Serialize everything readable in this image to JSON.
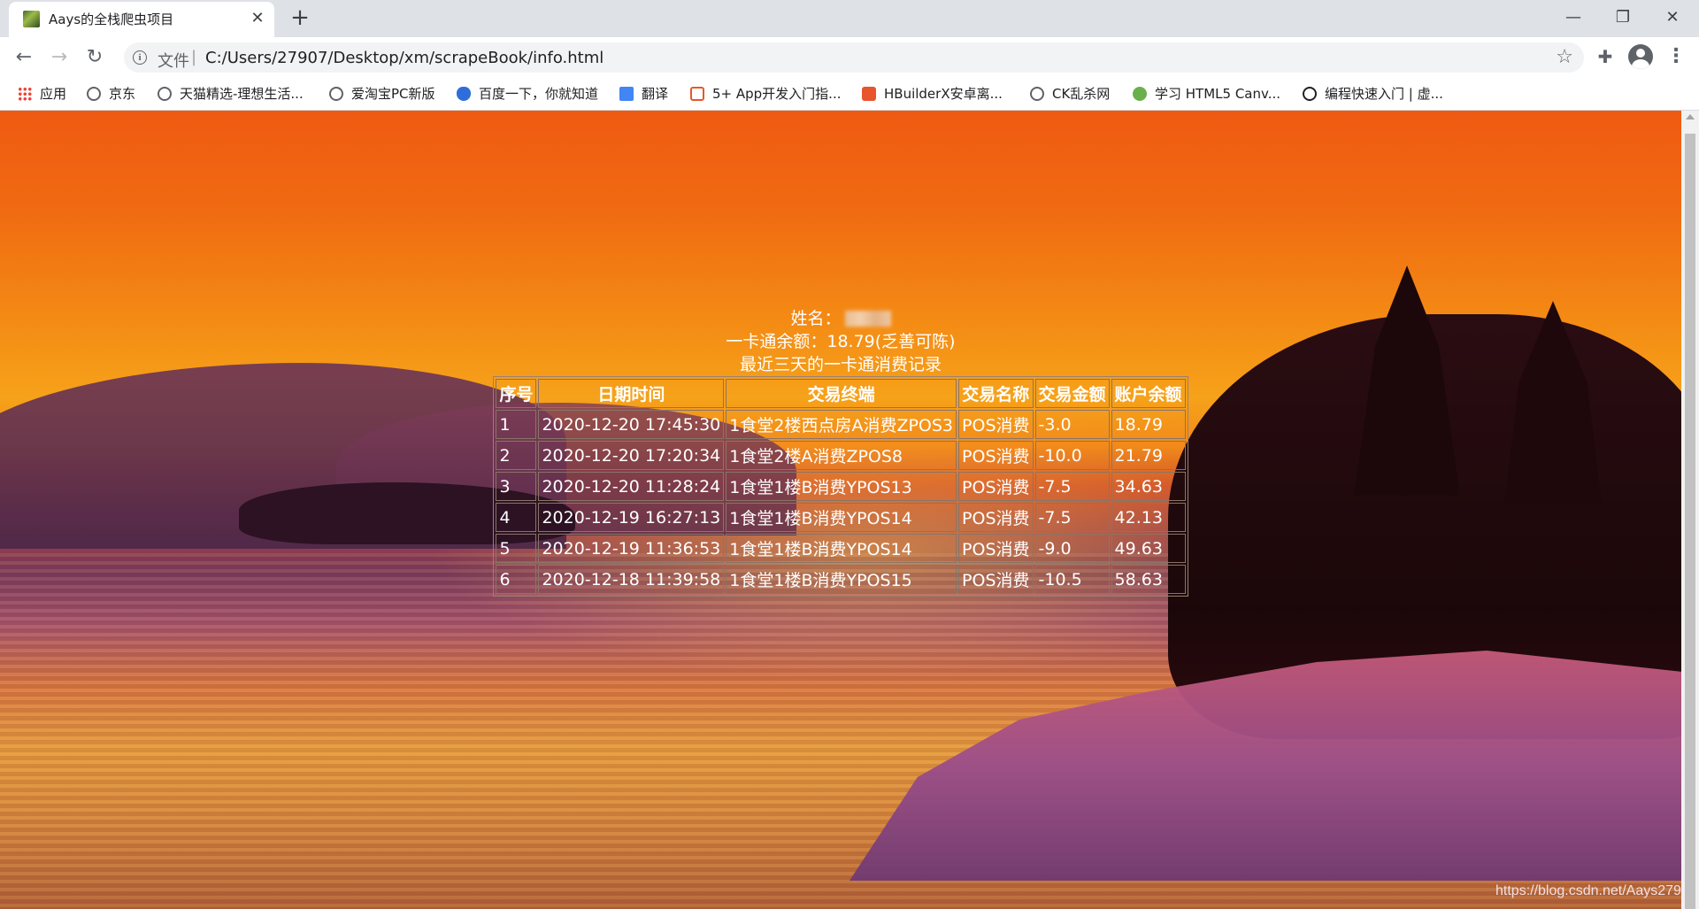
{
  "browser": {
    "tab_title": "Aays的全栈爬虫项目",
    "tab_close": "✕",
    "new_tab": "+",
    "window_minimize": "—",
    "window_restore": "❐",
    "window_close": "✕",
    "nav_back": "←",
    "nav_forward": "→",
    "nav_reload": "↻",
    "address_scheme": "文件",
    "address_separator": "|",
    "address_url": "C:/Users/27907/Desktop/xm/scrapeBook/info.html",
    "bookmark_star": "☆",
    "extensions_icon": "✚",
    "menu_icon": "⋮",
    "bookmarks": [
      {
        "label": "应用",
        "icon": "apps-grid-icon"
      },
      {
        "label": "京东",
        "icon": "globe-icon"
      },
      {
        "label": "天猫精选-理想生活...",
        "icon": "globe-icon"
      },
      {
        "label": "爱淘宝PC新版",
        "icon": "globe-icon"
      },
      {
        "label": "百度一下，你就知道",
        "icon": "baidu-paw-icon"
      },
      {
        "label": "翻译",
        "icon": "translate-icon"
      },
      {
        "label": "5+ App开发入门指...",
        "icon": "dcloud-icon"
      },
      {
        "label": "HBuilderX安卓离...",
        "icon": "hbuilder-icon"
      },
      {
        "label": "CK乱杀网",
        "icon": "globe-icon"
      },
      {
        "label": "学习 HTML5 Canv...",
        "icon": "html5-icon"
      },
      {
        "label": "编程快速入门 | 虚...",
        "icon": "unity-icon"
      }
    ]
  },
  "page": {
    "name_label": "姓名：",
    "balance_line": "一卡通余额：18.79(乏善可陈)",
    "records_title": "最近三天的一卡通消费记录",
    "table": {
      "headers": [
        "序号",
        "日期时间",
        "交易终端",
        "交易名称",
        "交易金额",
        "账户余额"
      ],
      "rows": [
        [
          "1",
          "2020-12-20 17:45:30",
          "1食堂2楼西点房A消费ZPOS3",
          "POS消费",
          "-3.0",
          "18.79"
        ],
        [
          "2",
          "2020-12-20 17:20:34",
          "1食堂2楼A消费ZPOS8",
          "POS消费",
          "-10.0",
          "21.79"
        ],
        [
          "3",
          "2020-12-20 11:28:24",
          "1食堂1楼B消费YPOS13",
          "POS消费",
          "-7.5",
          "34.63"
        ],
        [
          "4",
          "2020-12-19 16:27:13",
          "1食堂1楼B消费YPOS14",
          "POS消费",
          "-7.5",
          "42.13"
        ],
        [
          "5",
          "2020-12-19 11:36:53",
          "1食堂1楼B消费YPOS14",
          "POS消费",
          "-9.0",
          "49.63"
        ],
        [
          "6",
          "2020-12-18 11:39:58",
          "1食堂1楼B消费YPOS15",
          "POS消费",
          "-10.5",
          "58.63"
        ]
      ]
    },
    "watermark": "https://blog.csdn.net/Aays279"
  }
}
